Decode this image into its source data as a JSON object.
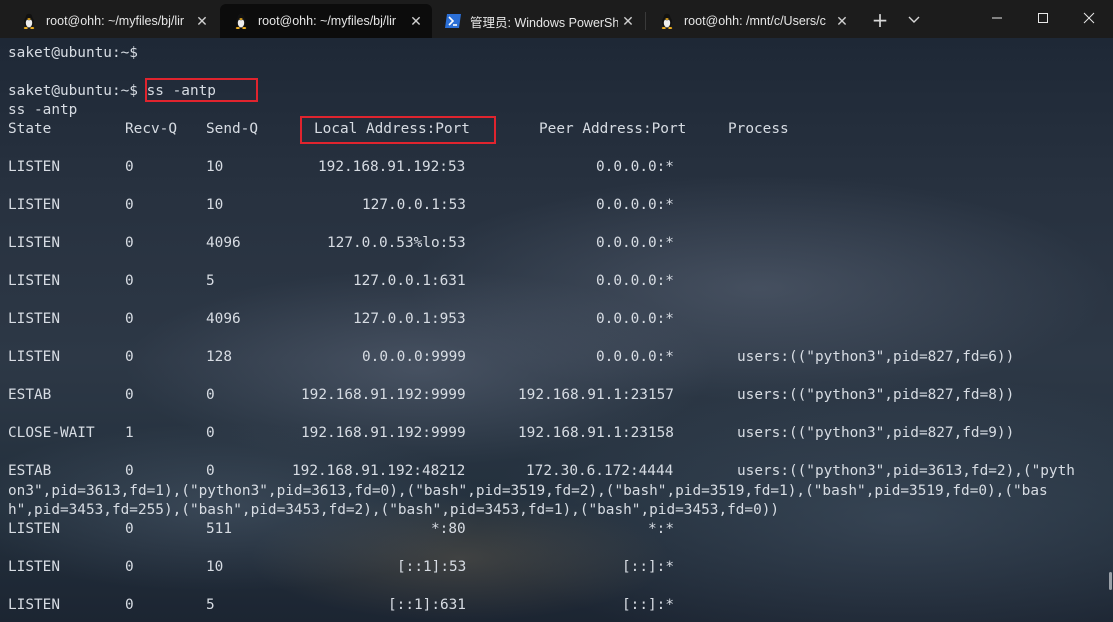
{
  "tabs": [
    {
      "title": "root@ohh: ~/myfiles/bj/lir",
      "icon": "linux-penguin-icon"
    },
    {
      "title": "root@ohh: ~/myfiles/bj/lir",
      "icon": "linux-penguin-icon"
    },
    {
      "title": "管理员: Windows PowerSh",
      "icon": "powershell-icon"
    },
    {
      "title": "root@ohh: /mnt/c/Users/c",
      "icon": "linux-penguin-icon"
    }
  ],
  "tab_close_glyph": "✕",
  "new_tab_glyph": "+",
  "dropdown_glyph": "⌄",
  "terminal": {
    "prompt1": "saket@ubuntu:~$",
    "prompt2": "saket@ubuntu:~$",
    "command": "ss -antp",
    "echo": "ss -antp",
    "headers": {
      "state": "State",
      "recvq": "Recv-Q",
      "sendq": "Send-Q",
      "local": "Local Address:Port",
      "peer": "Peer Address:Port",
      "process": "Process"
    },
    "rows": [
      {
        "state": "LISTEN",
        "recvq": "0",
        "sendq": "10",
        "local": "192.168.91.192:53",
        "peer": "0.0.0.0:*",
        "process": ""
      },
      {
        "state": "LISTEN",
        "recvq": "0",
        "sendq": "10",
        "local": "127.0.0.1:53",
        "peer": "0.0.0.0:*",
        "process": ""
      },
      {
        "state": "LISTEN",
        "recvq": "0",
        "sendq": "4096",
        "local": "127.0.0.53%lo:53",
        "peer": "0.0.0.0:*",
        "process": ""
      },
      {
        "state": "LISTEN",
        "recvq": "0",
        "sendq": "5",
        "local": "127.0.0.1:631",
        "peer": "0.0.0.0:*",
        "process": ""
      },
      {
        "state": "LISTEN",
        "recvq": "0",
        "sendq": "4096",
        "local": "127.0.0.1:953",
        "peer": "0.0.0.0:*",
        "process": ""
      },
      {
        "state": "LISTEN",
        "recvq": "0",
        "sendq": "128",
        "local": "0.0.0.0:9999",
        "peer": "0.0.0.0:*",
        "process": "users:((\"python3\",pid=827,fd=6))"
      },
      {
        "state": "ESTAB",
        "recvq": "0",
        "sendq": "0",
        "local": "192.168.91.192:9999",
        "peer": "192.168.91.1:23157",
        "process": "users:((\"python3\",pid=827,fd=8))"
      },
      {
        "state": "CLOSE-WAIT",
        "recvq": "1",
        "sendq": "0",
        "local": "192.168.91.192:9999",
        "peer": "192.168.91.1:23158",
        "process": "users:((\"python3\",pid=827,fd=9))"
      },
      {
        "state": "ESTAB",
        "recvq": "0",
        "sendq": "0",
        "local": "192.168.91.192:48212",
        "peer": "172.30.6.172:4444",
        "process": "users:((\"python3\",pid=3613,fd=2),(\"pyth"
      },
      {
        "state": "LISTEN",
        "recvq": "0",
        "sendq": "511",
        "local": "*:80",
        "peer": "*:*",
        "process": ""
      },
      {
        "state": "LISTEN",
        "recvq": "0",
        "sendq": "10",
        "local": "[::1]:53",
        "peer": "[::]:*",
        "process": ""
      },
      {
        "state": "LISTEN",
        "recvq": "0",
        "sendq": "5",
        "local": "[::1]:631",
        "peer": "[::]:*",
        "process": ""
      }
    ],
    "wrap_line1": "on3\",pid=3613,fd=1),(\"python3\",pid=3613,fd=0),(\"bash\",pid=3519,fd=2),(\"bash\",pid=3519,fd=1),(\"bash\",pid=3519,fd=0),(\"bas",
    "wrap_line2": "h\",pid=3453,fd=255),(\"bash\",pid=3453,fd=2),(\"bash\",pid=3453,fd=1),(\"bash\",pid=3453,fd=0))"
  },
  "colors": {
    "highlight_box": "#e0242e",
    "text": "#d7dce3",
    "titlebar": "#1c1c1c",
    "active_tab": "#0c0c0c"
  }
}
